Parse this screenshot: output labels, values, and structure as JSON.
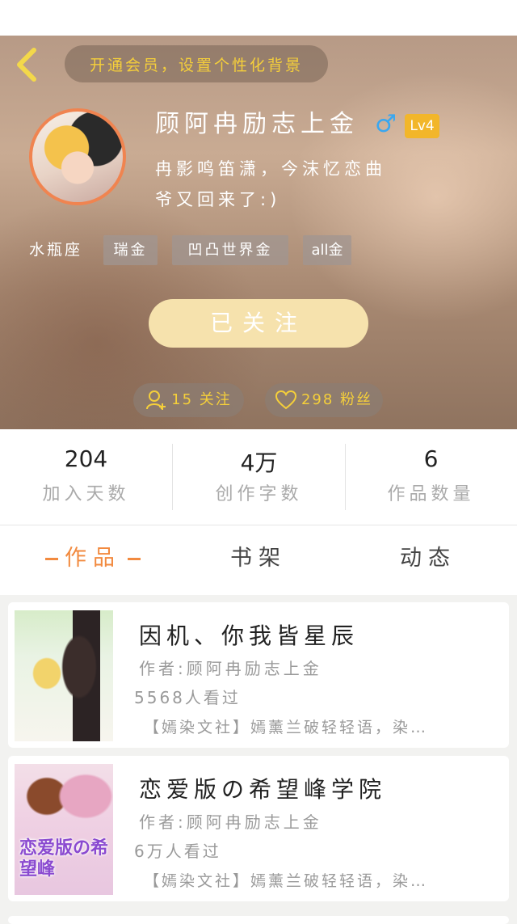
{
  "header": {
    "vip_banner": "开通会员，设置个性化背景",
    "username": "顾阿冉励志上金",
    "gender_symbol": "♂",
    "level": "Lv4",
    "bio_line1": "冉影鸣笛潇，今沫忆恋曲",
    "bio_line2": "爷又回来了:)",
    "constellation": "水瓶座",
    "tags": [
      "瑞金",
      "凹凸世界金",
      "all金"
    ],
    "follow_button": "已关注",
    "following_label": "15 关注",
    "fans_label": "298 粉丝"
  },
  "stats": [
    {
      "value": "204",
      "label": "加入天数"
    },
    {
      "value": "4万",
      "label": "创作字数"
    },
    {
      "value": "6",
      "label": "作品数量"
    }
  ],
  "tabs": [
    {
      "label": "作品",
      "active": true
    },
    {
      "label": "书架",
      "active": false
    },
    {
      "label": "动态",
      "active": false
    }
  ],
  "works": [
    {
      "title": "因机、你我皆星辰",
      "author": "作者:顾阿冉励志上金",
      "views": "5568人看过",
      "description": "【嫣染文社】嫣薰兰破轻轻语，染…"
    },
    {
      "title": "恋爱版の希望峰学院",
      "author": "作者:顾阿冉励志上金",
      "views": "6万人看过",
      "description": "【嫣染文社】嫣薰兰破轻轻语，染…",
      "cover_text": "恋爱版の希望峰"
    }
  ],
  "colors": {
    "accent": "#f28a3f",
    "banner_text": "#f5cf3a",
    "level_badge": "#f2b62a",
    "gender": "#3aa7f0"
  }
}
